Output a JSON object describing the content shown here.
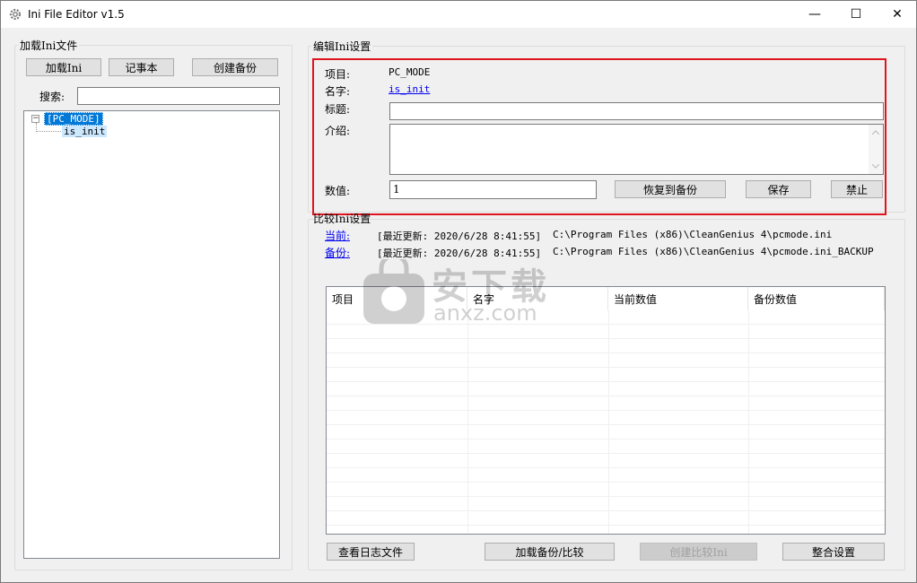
{
  "window": {
    "title": "Ini File Editor v1.5",
    "controls": {
      "minimize": "—",
      "maximize": "☐",
      "close": "✕"
    }
  },
  "load_group": {
    "label": "加载Ini文件",
    "buttons": {
      "load": "加载Ini",
      "notepad": "记事本",
      "create_backup": "创建备份"
    },
    "search_label": "搜索:",
    "search_value": "",
    "tree": {
      "root": "[PC_MODE]",
      "child": "is_init",
      "expander": "−"
    }
  },
  "edit_group": {
    "label": "编辑Ini设置",
    "item_label": "项目:",
    "item_value": "PC_MODE",
    "name_label": "名字:",
    "name_value": "is_init",
    "title_label": "标题:",
    "title_value": "",
    "intro_label": "介绍:",
    "intro_value": "",
    "value_label": "数值:",
    "value_value": "1",
    "buttons": {
      "restore": "恢复到备份",
      "save": "保存",
      "disable": "禁止"
    }
  },
  "compare_group": {
    "label": "比较Ini设置",
    "current_link": "当前:",
    "current_updated": "[最近更新: 2020/6/28 8:41:55]",
    "current_path": "C:\\Program Files (x86)\\CleanGenius 4\\pcmode.ini",
    "backup_link": "备份:",
    "backup_updated": "[最近更新: 2020/6/28 8:41:55]",
    "backup_path": "C:\\Program Files (x86)\\CleanGenius 4\\pcmode.ini_BACKUP",
    "columns": [
      "项目",
      "名字",
      "当前数值",
      "备份数值"
    ],
    "buttons": {
      "view_log": "查看日志文件",
      "load_compare": "加载备份/比较",
      "create_compare": "创建比较Ini",
      "merge": "整合设置"
    }
  },
  "watermark": {
    "text_cn": "安下载",
    "text_en": "anxz.com"
  },
  "colors": {
    "highlight": "#e0141e",
    "link": "#0000ee",
    "selection": "#0078d7"
  }
}
